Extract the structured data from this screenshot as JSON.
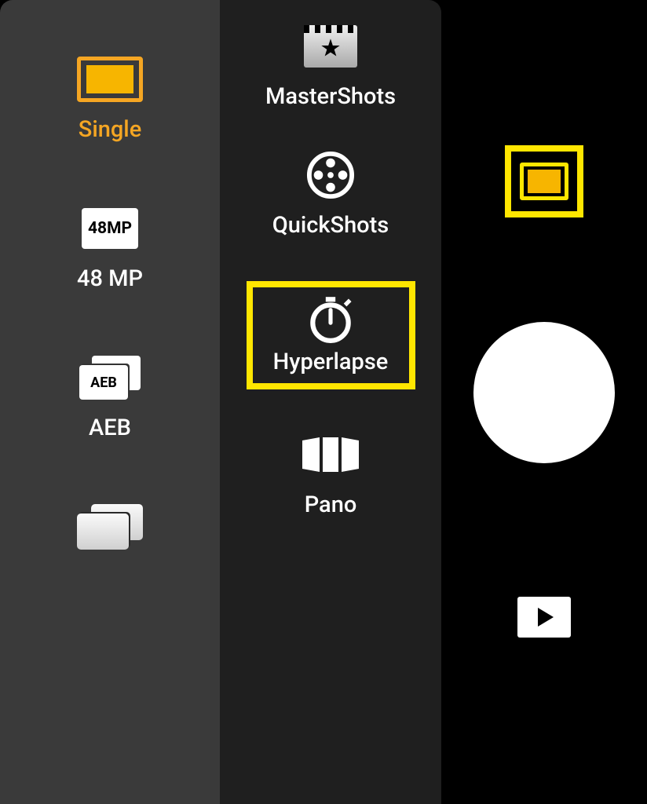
{
  "col1": {
    "items": [
      {
        "id": "single",
        "label": "Single",
        "selected": true
      },
      {
        "id": "48mp",
        "label": "48 MP",
        "badge": "48MP"
      },
      {
        "id": "aeb",
        "label": "AEB",
        "badge": "AEB"
      },
      {
        "id": "burst",
        "label": ""
      }
    ]
  },
  "col2": {
    "items": [
      {
        "id": "mastershots",
        "label": "MasterShots"
      },
      {
        "id": "quickshots",
        "label": "QuickShots"
      },
      {
        "id": "hyperlapse",
        "label": "Hyperlapse",
        "highlighted": true
      },
      {
        "id": "pano",
        "label": "Pano"
      }
    ]
  },
  "accent_color": "#f5a623",
  "highlight_color": "#ffe600"
}
